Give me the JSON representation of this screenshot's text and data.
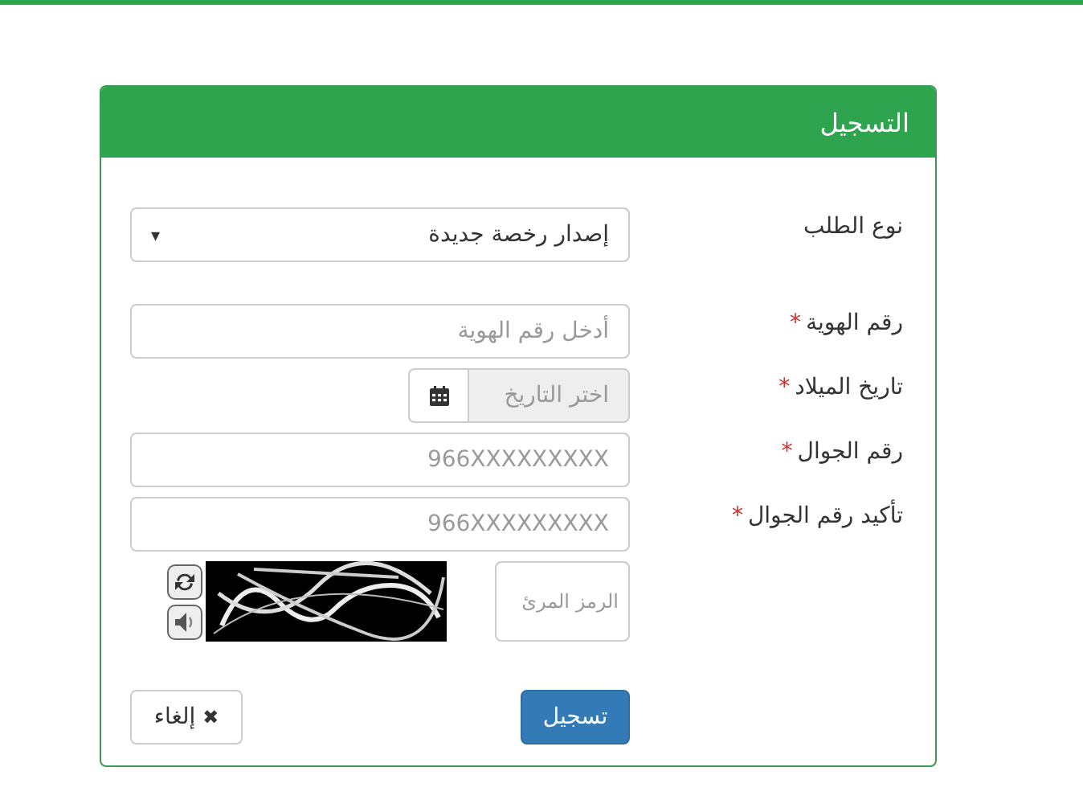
{
  "panel": {
    "title": "التسجيل"
  },
  "fields": [
    {
      "kind": "select",
      "label": "نوع الطلب",
      "value": "إصدار رخصة جديدة",
      "caret": "▾"
    },
    {
      "kind": "input",
      "label": "رقم الهوية",
      "required_mark": "*",
      "placeholder": "أدخل رقم الهوية"
    },
    {
      "kind": "date",
      "label": "تاريخ الميلاد",
      "required_mark": "*",
      "placeholder": "اختر التاريخ"
    },
    {
      "kind": "input",
      "label": "رقم الجوال",
      "required_mark": "*",
      "placeholder": "966XXXXXXXXX"
    },
    {
      "kind": "input",
      "label": "تأكيد رقم الجوال",
      "required_mark": "*",
      "placeholder": "966XXXXXXXXX"
    },
    {
      "kind": "captcha",
      "placeholder": "الرمز المرئ"
    }
  ],
  "buttons": [
    {
      "kind": "primary",
      "label": "تسجيل"
    },
    {
      "kind": "cancel",
      "label": "إلغاء",
      "icon": "✖"
    }
  ]
}
